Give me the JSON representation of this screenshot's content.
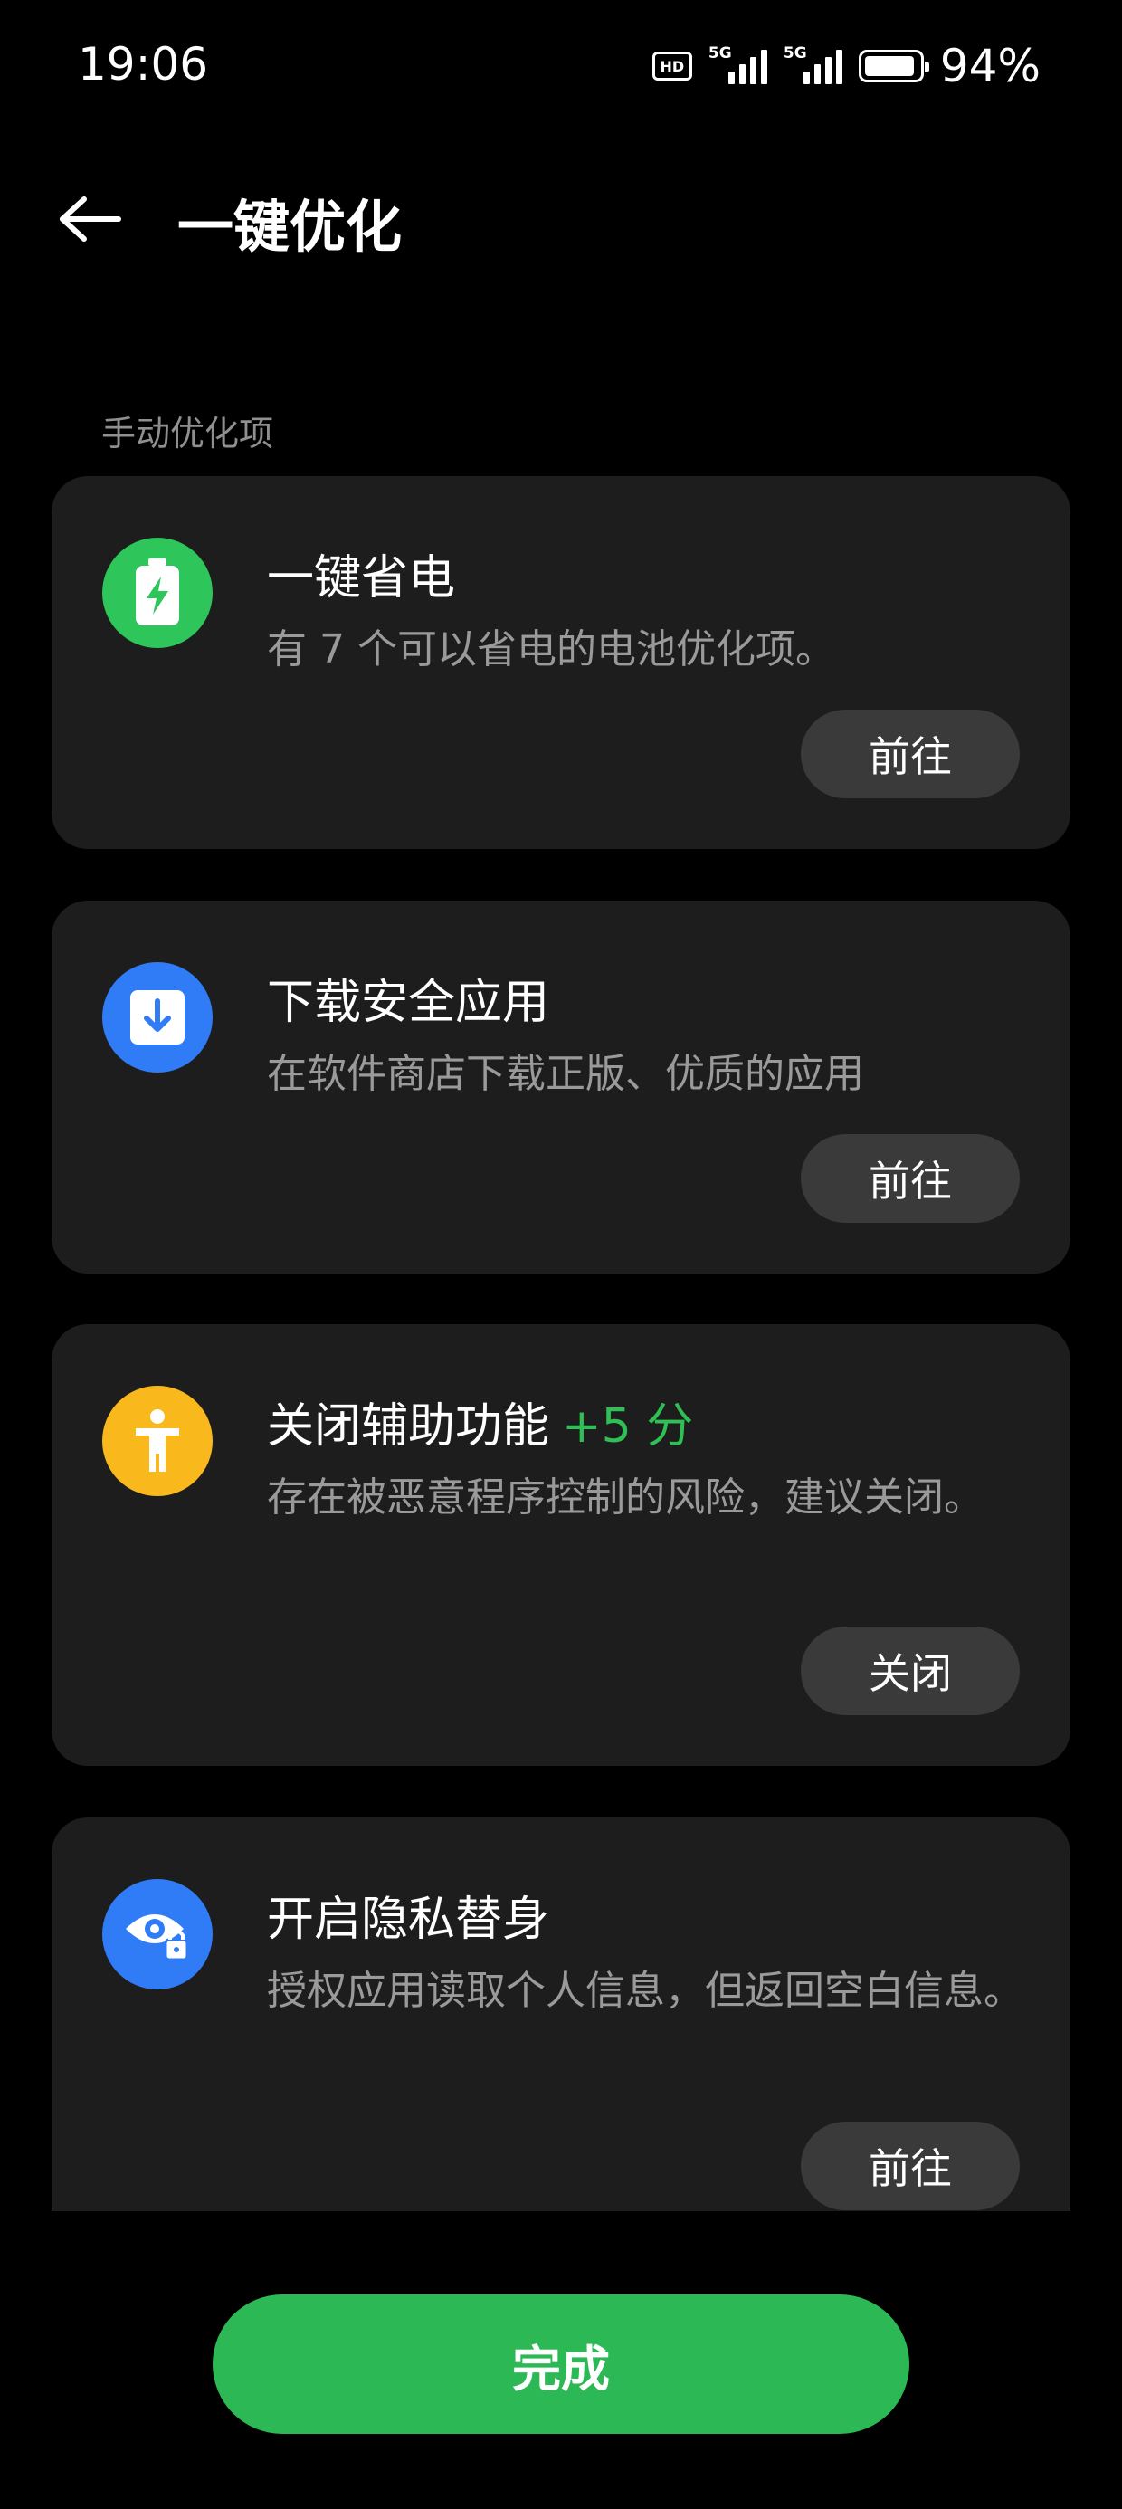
{
  "status_bar": {
    "time": "19:06",
    "hd_label": "HD",
    "network_1": "5G",
    "network_2": "5G",
    "battery_level": 0.94,
    "battery_text": "94%"
  },
  "header": {
    "title": "一键优化",
    "back_icon": "arrow-left-icon"
  },
  "section": {
    "label": "手动优化项"
  },
  "cards": [
    {
      "icon": "battery-charging-icon",
      "icon_color": "#2ec55a",
      "title": "一键省电",
      "score": "",
      "description": "有 7 个可以省电的电池优化项。",
      "button": "前往"
    },
    {
      "icon": "download-icon",
      "icon_color": "#2f7cf6",
      "title": "下载安全应用",
      "score": "",
      "description": "在软件商店下载正版、优质的应用",
      "button": "前往"
    },
    {
      "icon": "accessibility-icon",
      "icon_color": "#f9b91d",
      "title": "关闭辅助功能",
      "score": "+5 分",
      "description": "存在被恶意程序控制的风险，建议关闭。",
      "button": "关闭"
    },
    {
      "icon": "privacy-eye-lock-icon",
      "icon_color": "#2f7cf6",
      "title": "开启隐私替身",
      "score": "",
      "description": "授权应用读取个人信息，但返回空白信息。",
      "button": "前往"
    }
  ],
  "footer": {
    "done_label": "完成"
  },
  "colors": {
    "background": "#000000",
    "card": "#1d1d1d",
    "accent_green": "#2cb955",
    "score_green": "#2fbf55",
    "button_gray": "#3a3a3a"
  }
}
